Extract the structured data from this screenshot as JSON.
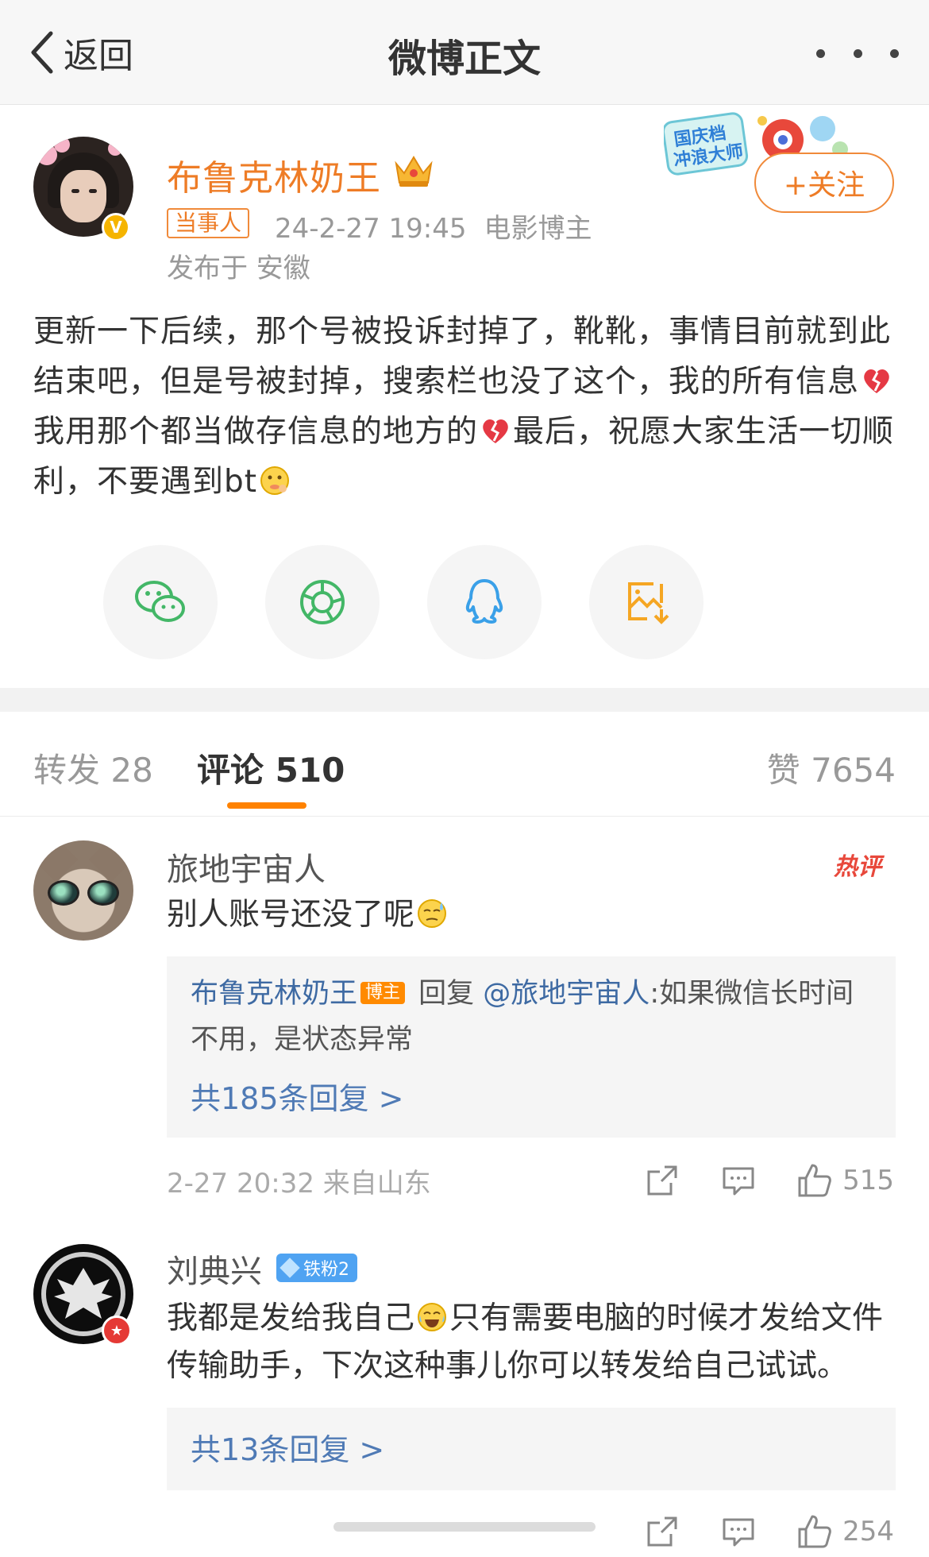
{
  "nav": {
    "back_label": "返回",
    "title": "微博正文"
  },
  "author": {
    "name": "布鲁克林奶王",
    "badge": "当事人",
    "timestamp": "24-2-27 19:45",
    "category": "电影博主",
    "location": "发布于 安徽",
    "follow_label": "+关注",
    "festival_badge": "国庆档冲浪大师"
  },
  "post": {
    "text_part1": "更新一下后续，那个号被投诉封掉了，靴靴，事情目前就到此结束吧，但是号被封掉，搜索栏也没了这个，我的所有信息",
    "text_part2": "我用那个都当做存信息的地方的",
    "text_part3": "最后，祝愿大家生活一切顺利，不要遇到bt"
  },
  "share": {
    "items": [
      "wechat-icon",
      "moments-icon",
      "qq-icon",
      "save-image-icon"
    ]
  },
  "tabs": {
    "repost": "转发 28",
    "comment": "评论 510",
    "like": "赞 7654"
  },
  "comments": [
    {
      "name": "旅地宇宙人",
      "tag": "热评",
      "text": "别人账号还没了呢",
      "reply": {
        "author": "布鲁克林奶王",
        "author_tag": "博主",
        "prefix": " 回复 ",
        "mention": "@旅地宇宙人",
        "text": ":如果微信长时间不用，是状态异常"
      },
      "more_replies": "共185条回复 >",
      "time": "2-27 20:32 来自山东",
      "likes": "515"
    },
    {
      "name": "刘典兴",
      "fan_badge": "铁粉2",
      "text": "我都是发给我自己",
      "text_rest": "只有需要电脑的时候才发给文件传输助手，下次这种事儿你可以转发给自己试试。",
      "more_replies": "共13条回复 >",
      "likes": "254"
    }
  ],
  "colors": {
    "accent": "#ff8200",
    "author_name": "#ee7c26",
    "link": "#4f7ab5",
    "hot": "#e8483b"
  }
}
